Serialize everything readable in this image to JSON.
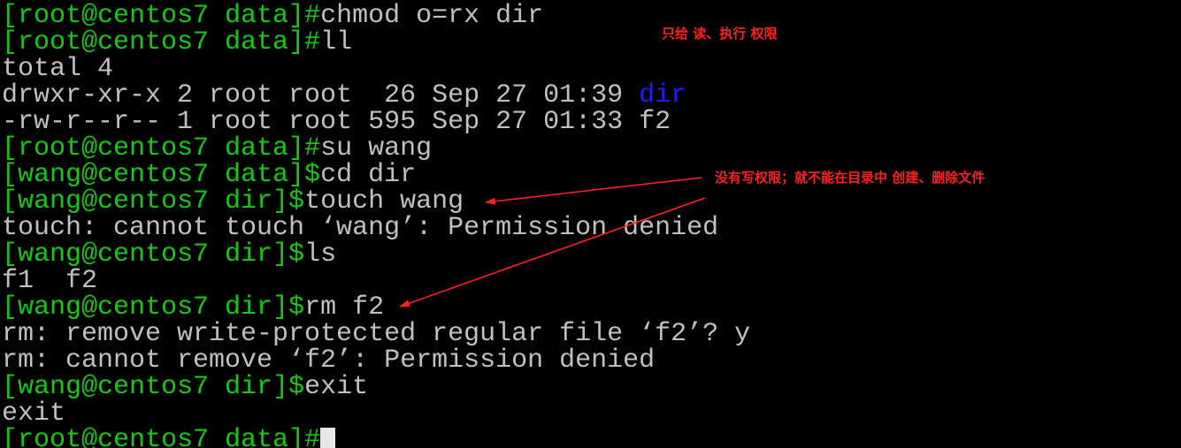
{
  "terminal": {
    "lines": [
      {
        "prompt": "[root@centos7 data]#",
        "cmd": "chmod o=rx dir"
      },
      {
        "prompt": "[root@centos7 data]#",
        "cmd": "ll"
      },
      {
        "out": "total 4"
      },
      {
        "out": "drwxr-xr-x 2 root root  26 Sep 27 01:39 ",
        "dir": "dir"
      },
      {
        "out": "-rw-r--r-- 1 root root 595 Sep 27 01:33 f2"
      },
      {
        "prompt": "[root@centos7 data]#",
        "cmd": "su wang"
      },
      {
        "prompt": "[wang@centos7 data]$",
        "cmd": "cd dir"
      },
      {
        "prompt": "[wang@centos7 dir]$",
        "cmd": "touch wang"
      },
      {
        "out": "touch: cannot touch ‘wang’: Permission denied"
      },
      {
        "prompt": "[wang@centos7 dir]$",
        "cmd": "ls"
      },
      {
        "out": "f1  f2"
      },
      {
        "prompt": "[wang@centos7 dir]$",
        "cmd": "rm f2"
      },
      {
        "out": "rm: remove write-protected regular file ‘f2’? y"
      },
      {
        "out": "rm: cannot remove ‘f2’: Permission denied"
      },
      {
        "prompt": "[wang@centos7 dir]$",
        "cmd": "exit"
      },
      {
        "out": "exit"
      },
      {
        "prompt": "[root@centos7 data]#",
        "cmd": ""
      }
    ]
  },
  "annotations": {
    "note1": "只给 读、执行 权限",
    "note2": "没有写权限；就不能在目录中 创建、删除文件"
  },
  "colors": {
    "background": "#000000",
    "prompt": "#17c617",
    "text": "#c0c0c0",
    "directory": "#1c1cff",
    "annotation": "#ff2020"
  }
}
